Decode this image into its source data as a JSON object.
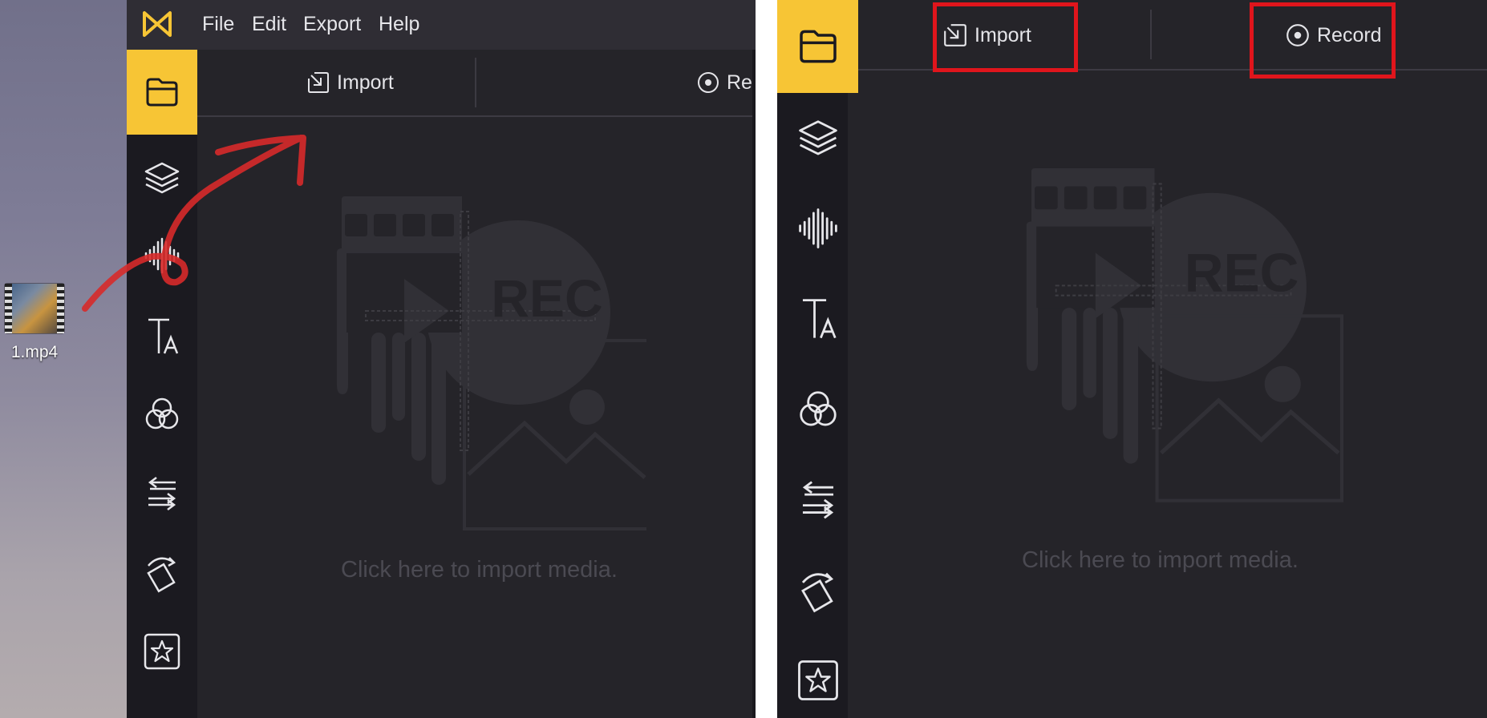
{
  "desktop": {
    "file_name": "1.mp4"
  },
  "menubar": {
    "items": [
      "File",
      "Edit",
      "Export",
      "Help"
    ]
  },
  "sidebar": {
    "items": [
      {
        "icon": "folder-icon",
        "active": true
      },
      {
        "icon": "layers-icon"
      },
      {
        "icon": "audio-waveform-icon"
      },
      {
        "icon": "text-icon"
      },
      {
        "icon": "filters-icon"
      },
      {
        "icon": "transitions-icon"
      },
      {
        "icon": "rotate-icon"
      },
      {
        "icon": "star-icon"
      }
    ]
  },
  "toolbar": {
    "import_label": "Import",
    "record_label": "Record"
  },
  "placeholder": {
    "badge_text": "REC",
    "hint": "Click here to import media."
  },
  "colors": {
    "accent": "#f7c535",
    "panel_bg": "#252429",
    "sidebar_bg": "#1b1a20",
    "highlight": "#e0151c",
    "annotation_arrow": "#d72a2a"
  }
}
